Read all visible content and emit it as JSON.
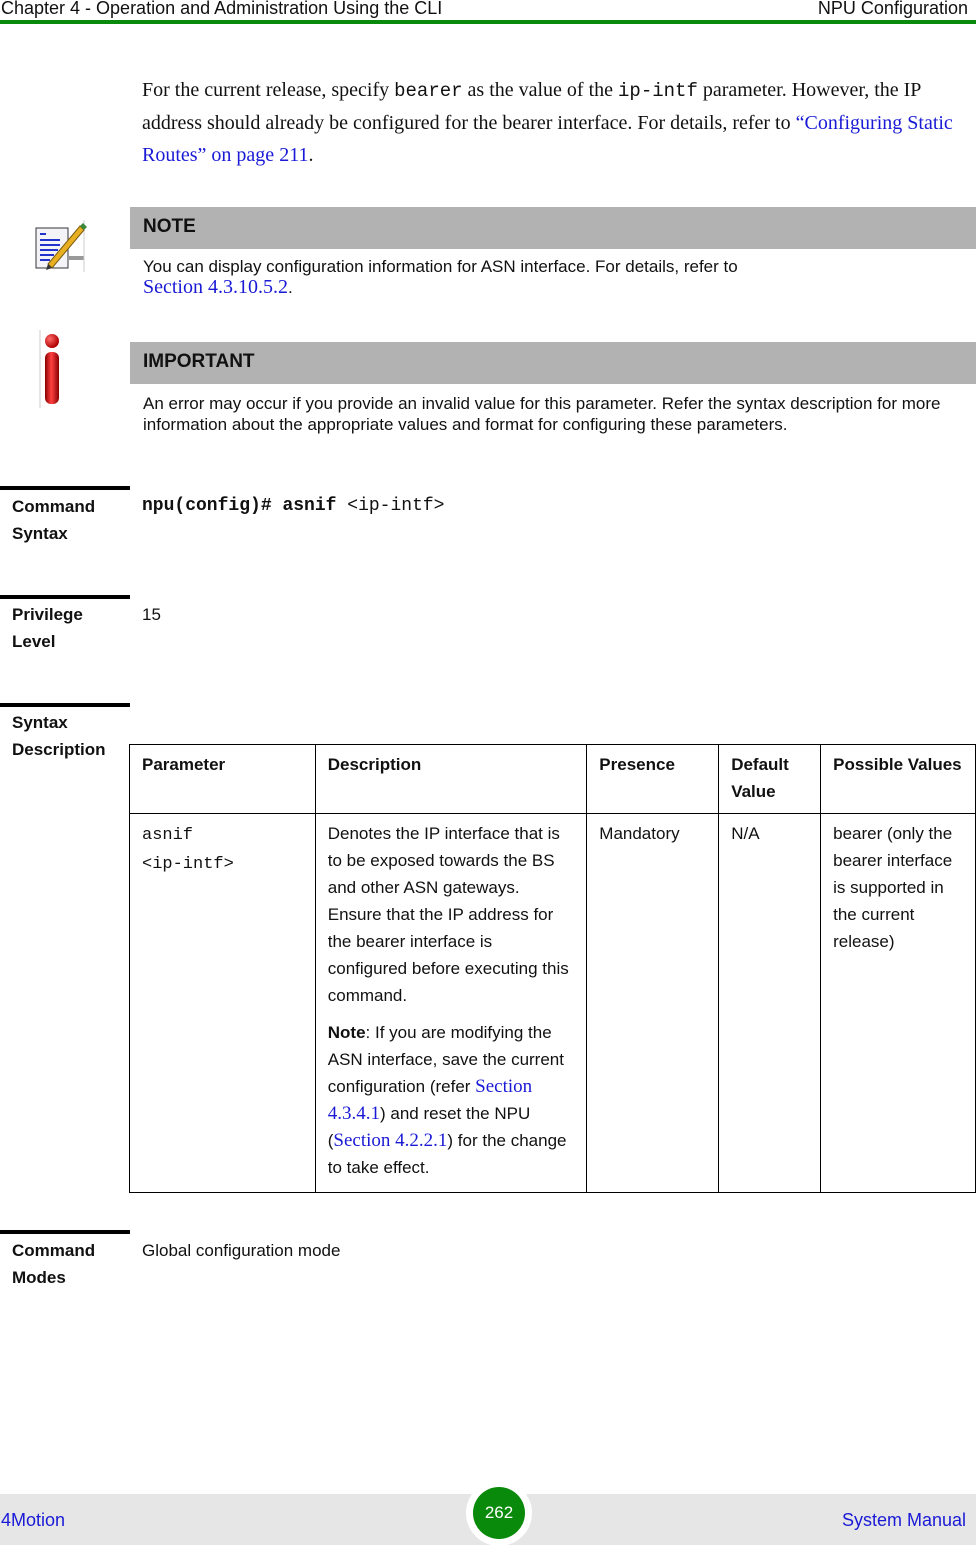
{
  "header": {
    "chapter": "Chapter 4 - Operation and Administration Using the CLI",
    "section": "NPU Configuration",
    "accent_color": "#0a8a0a"
  },
  "intro": {
    "t1": "For the current release, specify ",
    "code1": "bearer",
    "t2": " as the value of the ",
    "code2": "ip-intf",
    "t3": " parameter. However, the IP address should already be configured for the bearer interface. For details, refer to ",
    "link": "“Configuring Static Routes” on page 211",
    "t4": "."
  },
  "note": {
    "icon": "note-pencil-icon",
    "title": "NOTE",
    "text": "You can display configuration information for ASN interface. For details, refer to",
    "link": "Section 4.3.10.5.2",
    "suffix": "."
  },
  "important": {
    "icon": "important-info-icon",
    "title": "IMPORTANT",
    "text": "An error may occur if you provide an invalid value for this parameter. Refer the syntax description for more information about the appropriate values and format for configuring these parameters."
  },
  "command_syntax": {
    "label_line1": "Command",
    "label_line2": "Syntax",
    "prompt": "npu(config)#",
    "command": "asnif",
    "arg": "<ip-intf>"
  },
  "privilege_level": {
    "label_line1": "Privilege",
    "label_line2": "Level",
    "value": "15"
  },
  "syntax_description": {
    "label_line1": "Syntax",
    "label_line2": "Description",
    "columns": [
      "Parameter",
      "Description",
      "Presence",
      "Default Value",
      "Possible Values"
    ],
    "rows": [
      {
        "parameter_line1": "asnif",
        "parameter_line2": "<ip-intf>",
        "description": "Denotes the IP interface that is to be exposed towards the BS and other ASN gateways. Ensure that the IP address for the bearer interface is configured before executing this command.",
        "note_label": "Note",
        "note_t1": ": If you are modifying the ASN interface, save the current configuration (refer ",
        "note_link1": "Section 4.3.4.1",
        "note_t2": ") and reset the NPU (",
        "note_link2": "Section 4.2.2.1",
        "note_t3": ") for the change to take effect.",
        "presence": "Mandatory",
        "default_value": "N/A",
        "possible_values": "bearer (only the bearer interface is supported in the current release)"
      }
    ]
  },
  "command_modes": {
    "label_line1": "Command",
    "label_line2": "Modes",
    "value": "Global configuration mode"
  },
  "footer": {
    "product": "4Motion",
    "page": "262",
    "doc": "System Manual"
  }
}
